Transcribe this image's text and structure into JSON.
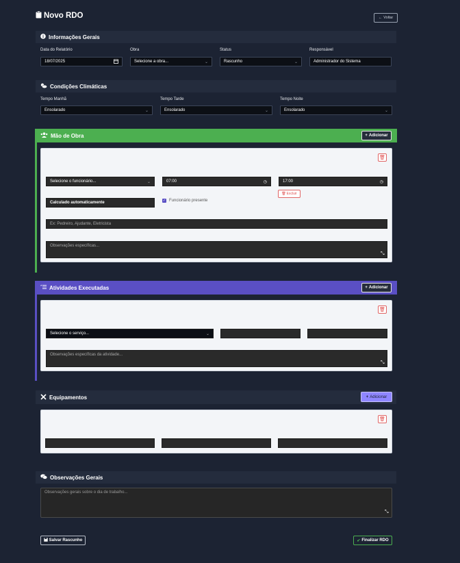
{
  "page": {
    "title": "Novo RDO",
    "back_label": "Voltar"
  },
  "info": {
    "heading": "Informações Gerais",
    "date_label": "Data do Relatório",
    "date_value": "18/07/2025",
    "obra_label": "Obra",
    "obra_value": "Selecione a obra...",
    "status_label": "Status",
    "status_value": "Rascunho",
    "resp_label": "Responsável",
    "resp_value": "Administrador do Sistema"
  },
  "weather": {
    "heading": "Condições Climáticas",
    "manha_label": "Tempo Manhã",
    "manha_value": "Ensolarado",
    "tarde_label": "Tempo Tarde",
    "tarde_value": "Ensolarado",
    "noite_label": "Tempo Noite",
    "noite_value": "Ensolarado"
  },
  "labor": {
    "heading": "Mão de Obra",
    "add_label": "Adicionar",
    "employee_value": "Selecione o funcionário...",
    "start_value": "07:00",
    "end_value": "17:00",
    "delete_label": "Excluir",
    "hours_value": "Calculado automaticamente",
    "present_label": "Funcionário presente",
    "role_placeholder": "Ex: Pedreiro, Ajudante, Eletricista",
    "notes_placeholder": "Observações específicas..."
  },
  "activities": {
    "heading": "Atividades Executadas",
    "add_label": "Adicionar",
    "service_value": "Selecione o serviço...",
    "notes_placeholder": "Observações específicas da atividade..."
  },
  "equipment": {
    "heading": "Equipamentos",
    "add_label": "Adicionar"
  },
  "general_notes": {
    "heading": "Observações Gerais",
    "placeholder": "Observações gerais sobre o dia de trabalho..."
  },
  "footer": {
    "save_label": "Salvar Rascunho",
    "finish_label": "Finalizar RDO"
  },
  "colors": {
    "labor_bar": "#4caf50",
    "activities_bar": "#5a4fc4",
    "equipment_add": "#8f86ff",
    "finish_border": "#4caf50"
  }
}
